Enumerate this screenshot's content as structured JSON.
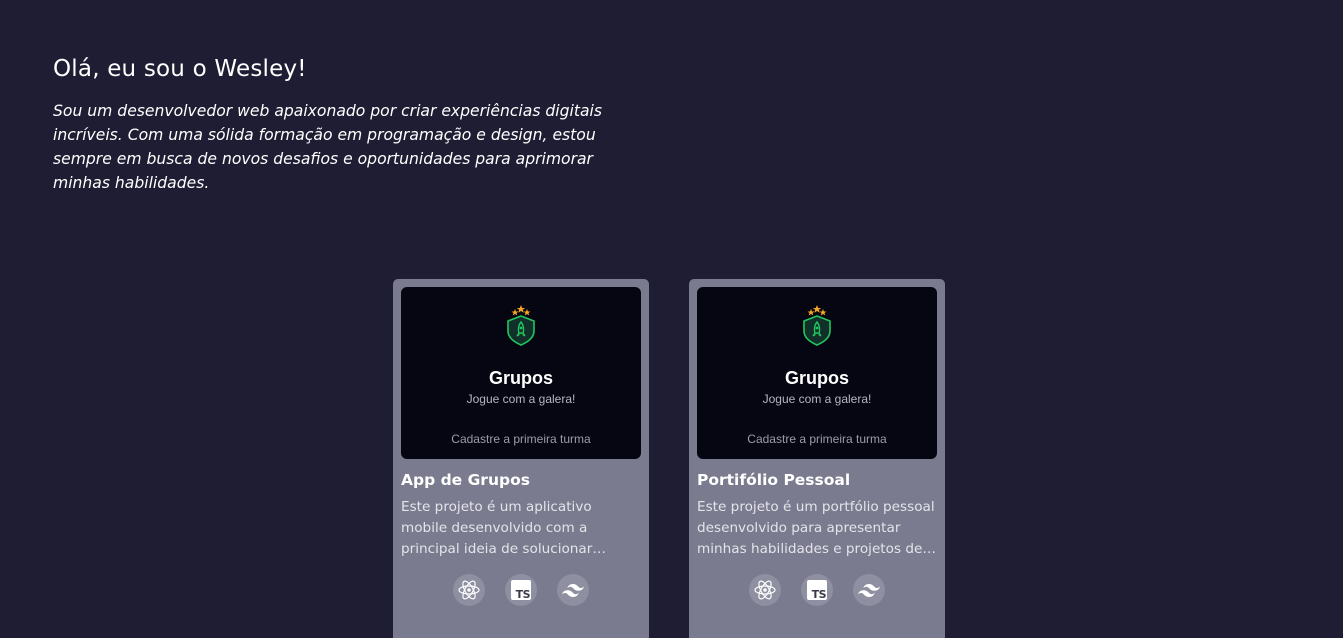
{
  "intro": {
    "greeting": "Olá, eu sou o Wesley!",
    "description": "Sou um desenvolvedor web apaixonado por criar experiências digitais incríveis. Com uma sólida formação em programação e design, estou sempre em busca de novos desafios e oportunidades para aprimorar minhas habilidades."
  },
  "projects": [
    {
      "preview": {
        "title": "Grupos",
        "subtitle": "Jogue com a galera!",
        "empty_text": "Cadastre a primeira turma"
      },
      "title": "App de Grupos",
      "description": "Este projeto é um aplicativo mobile desenvolvido com a principal ideia de solucionar problemas voltados para a organização de grupos.",
      "techs": [
        "react-icon",
        "typescript-icon",
        "tailwind-icon"
      ]
    },
    {
      "preview": {
        "title": "Grupos",
        "subtitle": "Jogue com a galera!",
        "empty_text": "Cadastre a primeira turma"
      },
      "title": "Portifólio Pessoal",
      "description": "Este projeto é um portfólio pessoal desenvolvido para apresentar minhas habilidades e projetos de forma simples.",
      "techs": [
        "react-icon",
        "typescript-icon",
        "tailwind-icon"
      ]
    }
  ],
  "colors": {
    "background": "#1e1d33",
    "card": "#7a7b8e",
    "preview": "#050611",
    "accent": "#22c55e"
  }
}
